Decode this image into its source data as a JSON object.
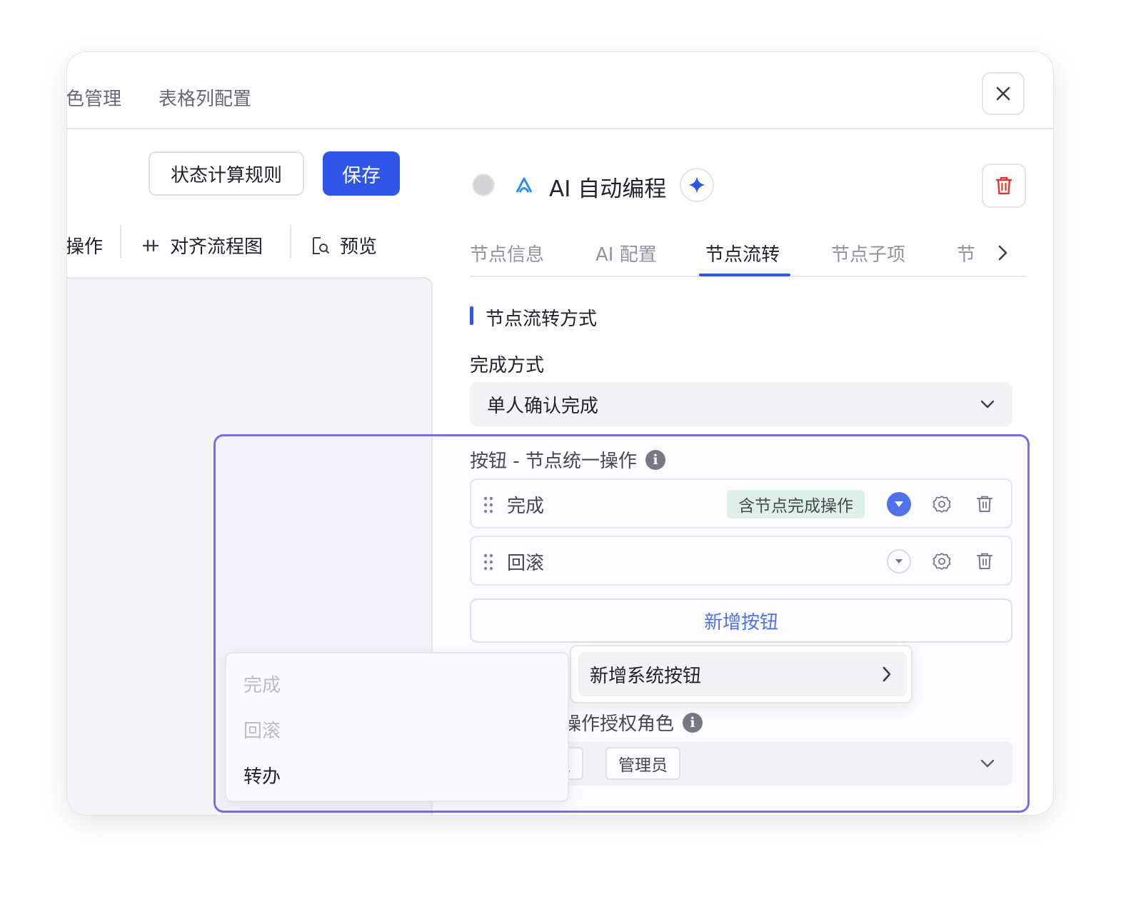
{
  "header": {
    "tabs": [
      {
        "label": "色管理"
      },
      {
        "label": "表格列配置"
      }
    ]
  },
  "left": {
    "rule_button": "状态计算规则",
    "save_button": "保存",
    "toolbar": {
      "op_label": "操作",
      "align_label": "对齐流程图",
      "preview_label": "预览"
    }
  },
  "node": {
    "title": "AI 自动编程",
    "tabs": [
      {
        "label": "节点信息"
      },
      {
        "label": "AI 配置"
      },
      {
        "label": "节点流转",
        "active": true
      },
      {
        "label": "节点子项"
      },
      {
        "label": "节"
      }
    ]
  },
  "flow": {
    "section_title": "节点流转方式",
    "completion_label": "完成方式",
    "completion_value": "单人确认完成",
    "buttons_label": "按钮 - 节点统一操作",
    "operations": [
      {
        "name": "完成",
        "tag": "含节点完成操作",
        "expanded": true
      },
      {
        "name": "回滚"
      }
    ],
    "add_button": "新增按钮",
    "permission_label": "操作授权角色",
    "permission_chips": [
      "人",
      "管理员"
    ]
  },
  "submenu": {
    "item": "新增系统按钮"
  },
  "dropdown": {
    "items": [
      {
        "label": "完成",
        "disabled": true
      },
      {
        "label": "回滚",
        "disabled": true
      },
      {
        "label": "转办",
        "disabled": false
      }
    ]
  },
  "colors": {
    "primary": "#2f56e6",
    "danger": "#e5322d",
    "tag_green_bg": "#d9f1e3",
    "highlight": "#7b6ce6"
  },
  "icons": {
    "close": "close-icon",
    "delete": "trash-icon",
    "sparkle": "sparkle-icon",
    "ai_logo": "ai-logo-icon",
    "align": "align-icon",
    "preview": "preview-icon",
    "drag": "drag-handle-icon",
    "settings": "gear-icon",
    "chevron": "chevron-down-icon",
    "info": "info-icon"
  }
}
